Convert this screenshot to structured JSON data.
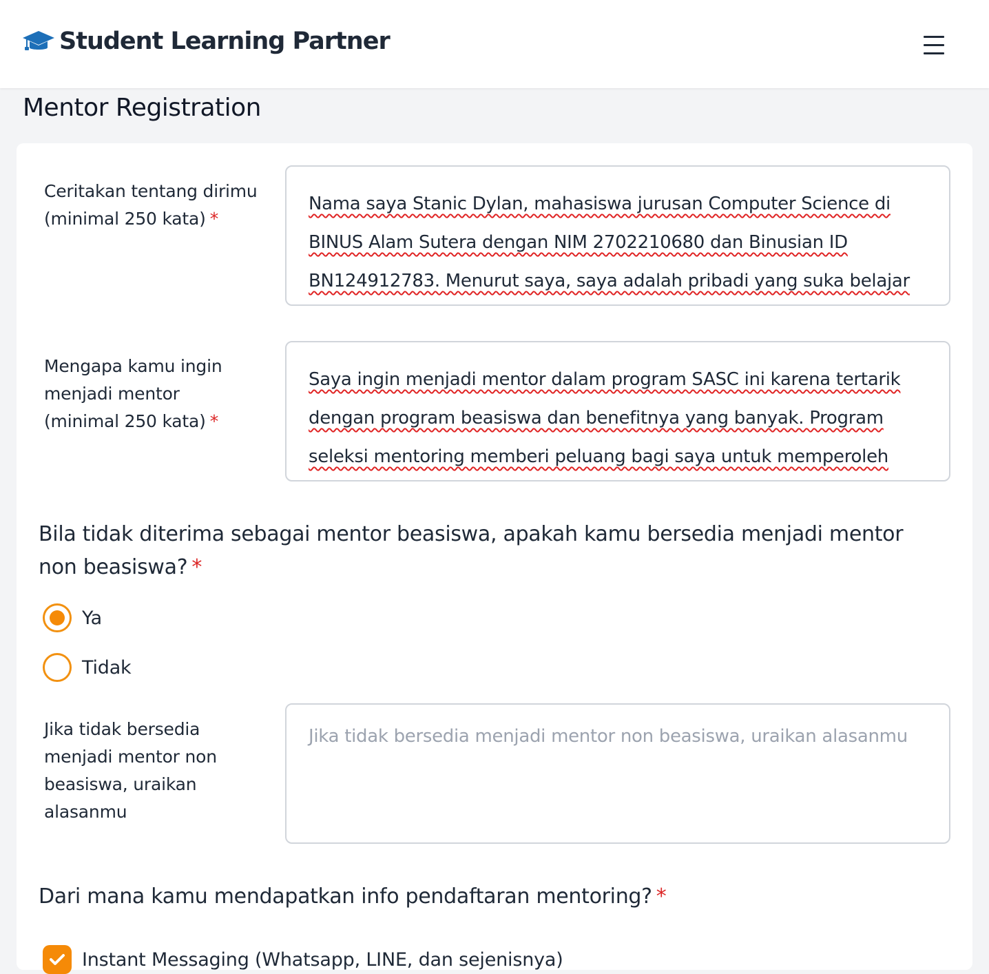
{
  "app": {
    "brand": "Student Learning Partner",
    "brand_icon": "graduation-cap-icon",
    "menu_icon": "hamburger-menu-icon"
  },
  "page": {
    "title": "Mentor Registration"
  },
  "form": {
    "about": {
      "label": "Ceritakan tentang dirimu (minimal 250 kata)",
      "required": "*",
      "value": "Nama saya Stanic Dylan, mahasiswa jurusan Computer Science di BINUS Alam Sutera dengan NIM 2702210680 dan Binusian ID BN124912783. Menurut saya, saya adalah pribadi yang suka belajar dan cenderung"
    },
    "motivation": {
      "label": "Mengapa kamu ingin menjadi mentor (minimal 250 kata)",
      "required": "*",
      "value": "Saya ingin menjadi mentor dalam program SASC ini karena tertarik dengan program beasiswa dan benefitnya yang banyak. Program seleksi mentoring memberi peluang bagi saya untuk memperoleh potongan"
    },
    "non_scholarship": {
      "question": "Bila tidak diterima sebagai mentor beasiswa, apakah kamu bersedia menjadi mentor non beasiswa?",
      "required": "*",
      "options": [
        {
          "label": "Ya",
          "selected": true
        },
        {
          "label": "Tidak",
          "selected": false
        }
      ]
    },
    "reason": {
      "label": "Jika tidak bersedia menjadi mentor non beasiswa, uraikan alasanmu",
      "value": "",
      "placeholder": "Jika tidak bersedia menjadi mentor non beasiswa, uraikan alasanmu"
    },
    "info_source": {
      "question": "Dari mana kamu mendapatkan info pendaftaran mentoring?",
      "required": "*",
      "options": [
        {
          "label": "Instant Messaging (Whatsapp, LINE, dan sejenisnya)",
          "checked": true
        }
      ]
    }
  },
  "colors": {
    "accent": "#f58a07",
    "required": "#dc2626",
    "brand_icon": "#1d6fb8",
    "spellcheck": "#e02424"
  }
}
